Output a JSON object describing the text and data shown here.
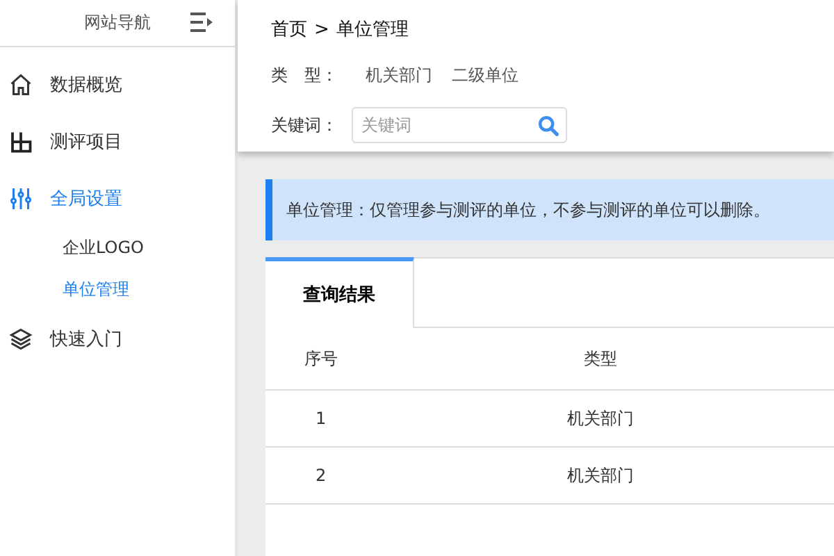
{
  "sidebar": {
    "title": "网站导航",
    "items": [
      {
        "label": "数据概览",
        "kind": "home",
        "selected": false
      },
      {
        "label": "测评项目",
        "kind": "grid",
        "selected": false
      },
      {
        "label": "全局设置",
        "kind": "sliders",
        "selected": true,
        "children": [
          {
            "label": "企业LOGO",
            "selected": false
          },
          {
            "label": "单位管理",
            "selected": true
          }
        ]
      },
      {
        "label": "快速入门",
        "kind": "layers",
        "selected": false
      }
    ]
  },
  "breadcrumb": {
    "home": "首页",
    "separator": ">",
    "current": "单位管理"
  },
  "filters": {
    "type_label": "类　型：",
    "type_options": [
      "机关部门",
      "二级单位"
    ],
    "keyword_label": "关键词：",
    "keyword": {
      "placeholder": "关键词"
    }
  },
  "notice": "单位管理：仅管理参与测评的单位，不参与测评的单位可以删除。",
  "tabs": [
    {
      "label": "查询结果",
      "selected": true
    }
  ],
  "table": {
    "columns": [
      "序号",
      "类型"
    ],
    "rows": [
      [
        "1",
        "机关部门"
      ],
      [
        "2",
        "机关部门"
      ]
    ]
  }
}
